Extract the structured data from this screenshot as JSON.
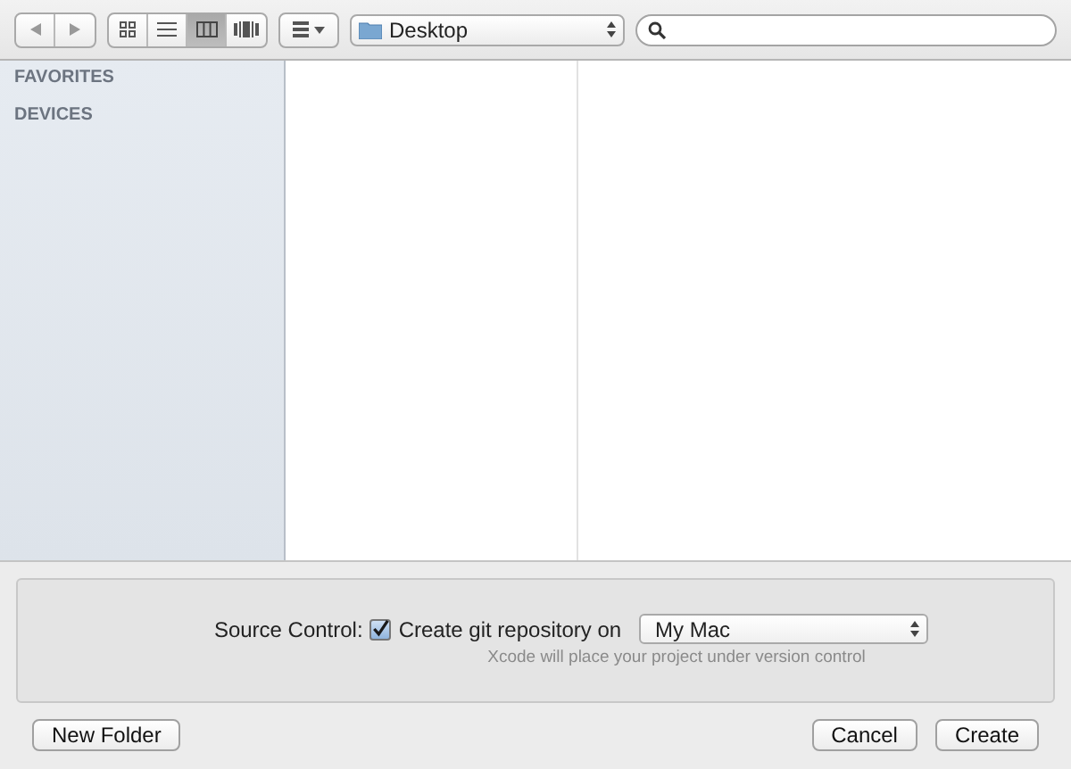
{
  "toolbar": {
    "view_modes": [
      {
        "kind": "icons",
        "selected": false
      },
      {
        "kind": "list",
        "selected": false
      },
      {
        "kind": "columns",
        "selected": true
      },
      {
        "kind": "coverflow",
        "selected": false
      }
    ],
    "location": "Desktop"
  },
  "sidebar": {
    "sections": [
      "FAVORITES",
      "DEVICES"
    ]
  },
  "source_control": {
    "label": "Source Control:",
    "checkbox": {
      "label": "Create git repository on",
      "checked": true
    },
    "destination": "My Mac",
    "hint": "Xcode will place your project under version control"
  },
  "buttons": {
    "left": [
      "New Folder"
    ],
    "right": [
      "Cancel",
      "Create"
    ]
  }
}
